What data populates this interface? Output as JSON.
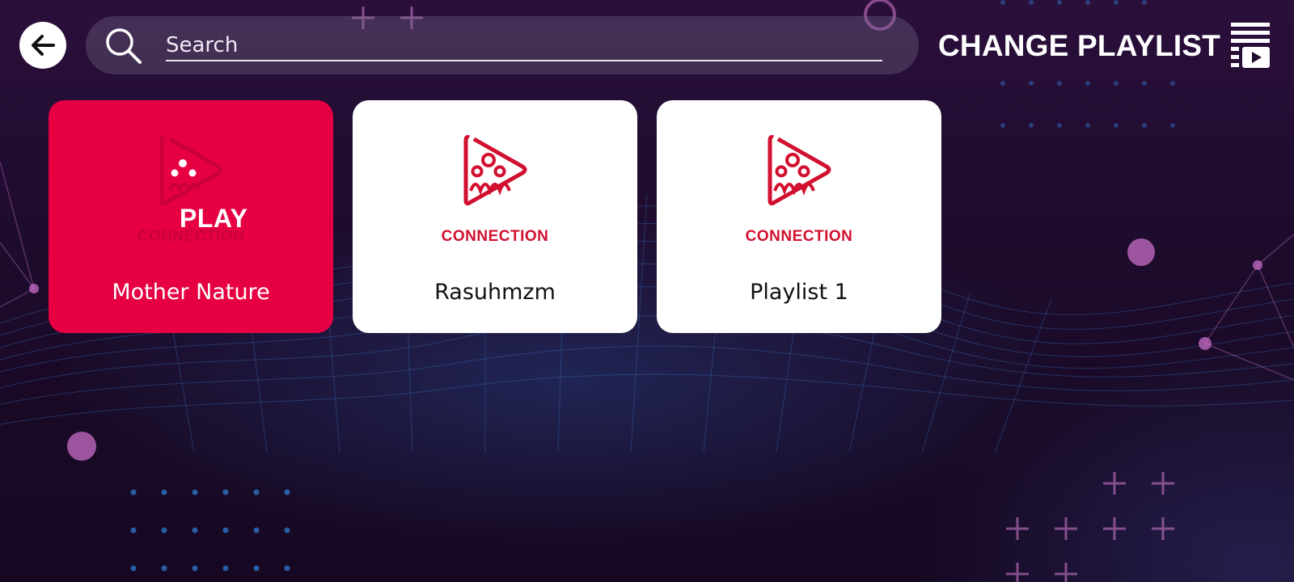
{
  "header": {
    "back_icon": "arrow-left-icon",
    "search_icon": "search-icon",
    "search_placeholder": "Search",
    "change_playlist_label": "CHANGE PLAYLIST",
    "playlist_icon": "playlist-play-icon"
  },
  "playlists": [
    {
      "name": "Mother Nature",
      "brand": "CONNECTION",
      "play_label": "PLAY",
      "selected": true
    },
    {
      "name": "Rasuhmzm",
      "brand": "CONNECTION",
      "selected": false
    },
    {
      "name": "Playlist 1",
      "brand": "CONNECTION",
      "selected": false
    }
  ],
  "colors": {
    "accent": "#e60043",
    "brand_red": "#d1102f",
    "background": "#1f0c2f"
  }
}
